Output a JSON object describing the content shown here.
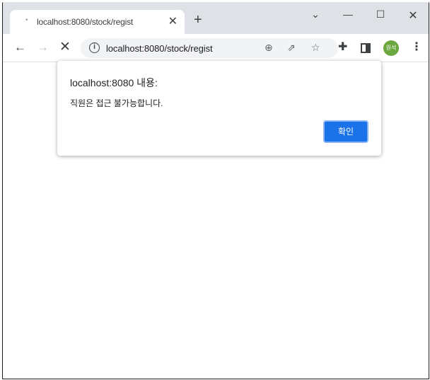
{
  "browser": {
    "tab_title": "localhost:8080/stock/regist",
    "tab_close": "✕",
    "new_tab": "+",
    "url": "localhost:8080/stock/regist",
    "profile_label": "원석"
  },
  "dialog": {
    "title": "localhost:8080 내용:",
    "message": "직원은 접근 불가능합니다.",
    "ok_label": "확인"
  },
  "colors": {
    "accent": "#1a73e8",
    "profile": "#6aa73e",
    "titlebar": "#dee1e6"
  },
  "icons": {
    "tab_favicon": "loading-dot-icon",
    "back": "back-arrow-icon",
    "forward": "forward-arrow-icon",
    "stop": "stop-icon",
    "info": "info-icon",
    "zoom": "zoom-icon",
    "share": "share-icon",
    "bookmark": "star-icon",
    "extensions": "puzzle-icon",
    "side_panel": "side-panel-icon",
    "menu": "kebab-menu-icon"
  }
}
